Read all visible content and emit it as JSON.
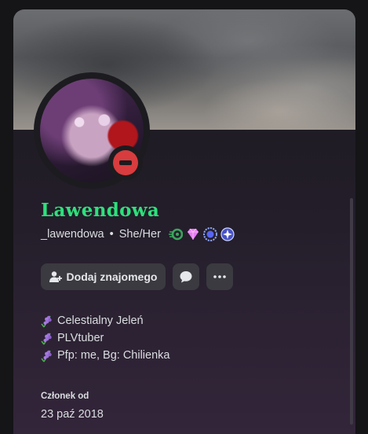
{
  "profile": {
    "display_name": "Lawendowa",
    "username": "_lawendowa",
    "separator": "•",
    "pronouns": "She/Her",
    "status": "do-not-disturb",
    "status_color": "#d83c3e",
    "name_color": "#2ee07c",
    "badges": [
      "nitro-icon",
      "server-boost-icon",
      "quest-badge-icon",
      "orbs-badge-icon"
    ]
  },
  "actions": {
    "add_friend_label": "Dodaj znajomego",
    "message_icon": "message-icon",
    "more_icon": "more-icon"
  },
  "bio": {
    "lines": [
      "Celestialny Jeleń",
      "PLVtuber",
      "Pfp: me, Bg: Chilienka"
    ],
    "emoji": "lavender-icon"
  },
  "member_since": {
    "label": "Członek od",
    "date": "23 paź 2018"
  }
}
